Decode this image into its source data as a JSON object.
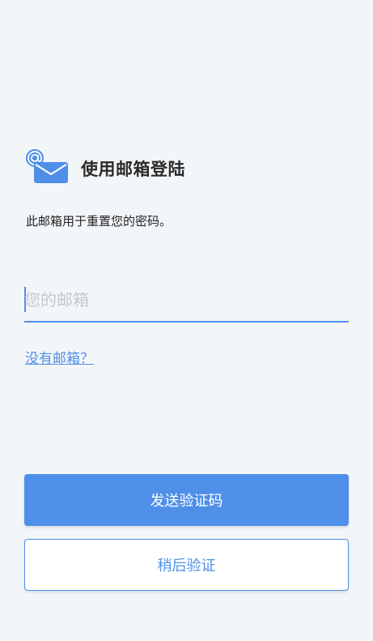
{
  "header": {
    "icon": "mail-at-icon",
    "title": "使用邮箱登陆"
  },
  "subtitle": "此邮箱用于重置您的密码。",
  "email_field": {
    "value": "",
    "placeholder": "您的邮箱"
  },
  "links": {
    "no_email": "没有邮箱？"
  },
  "buttons": {
    "send_code": "发送验证码",
    "verify_later": "稍后验证"
  },
  "colors": {
    "accent": "#4f8fe8",
    "background": "#f3f6f9"
  }
}
